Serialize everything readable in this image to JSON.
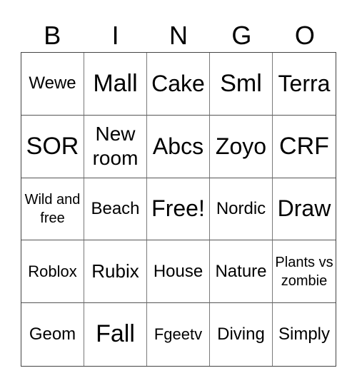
{
  "header": [
    "B",
    "I",
    "N",
    "G",
    "O"
  ],
  "cells": [
    [
      "Wewe",
      "Mall",
      "Cake",
      "Sml",
      "Terra"
    ],
    [
      "SOR",
      "New room",
      "Abcs",
      "Zoyo",
      "CRF"
    ],
    [
      "Wild and free",
      "Beach",
      "Free!",
      "Nordic",
      "Draw"
    ],
    [
      "Roblox",
      "Rubix",
      "House",
      "Nature",
      "Plants vs zombie"
    ],
    [
      "Geom",
      "Fall",
      "Fgeetv",
      "Diving",
      "Simply"
    ]
  ]
}
